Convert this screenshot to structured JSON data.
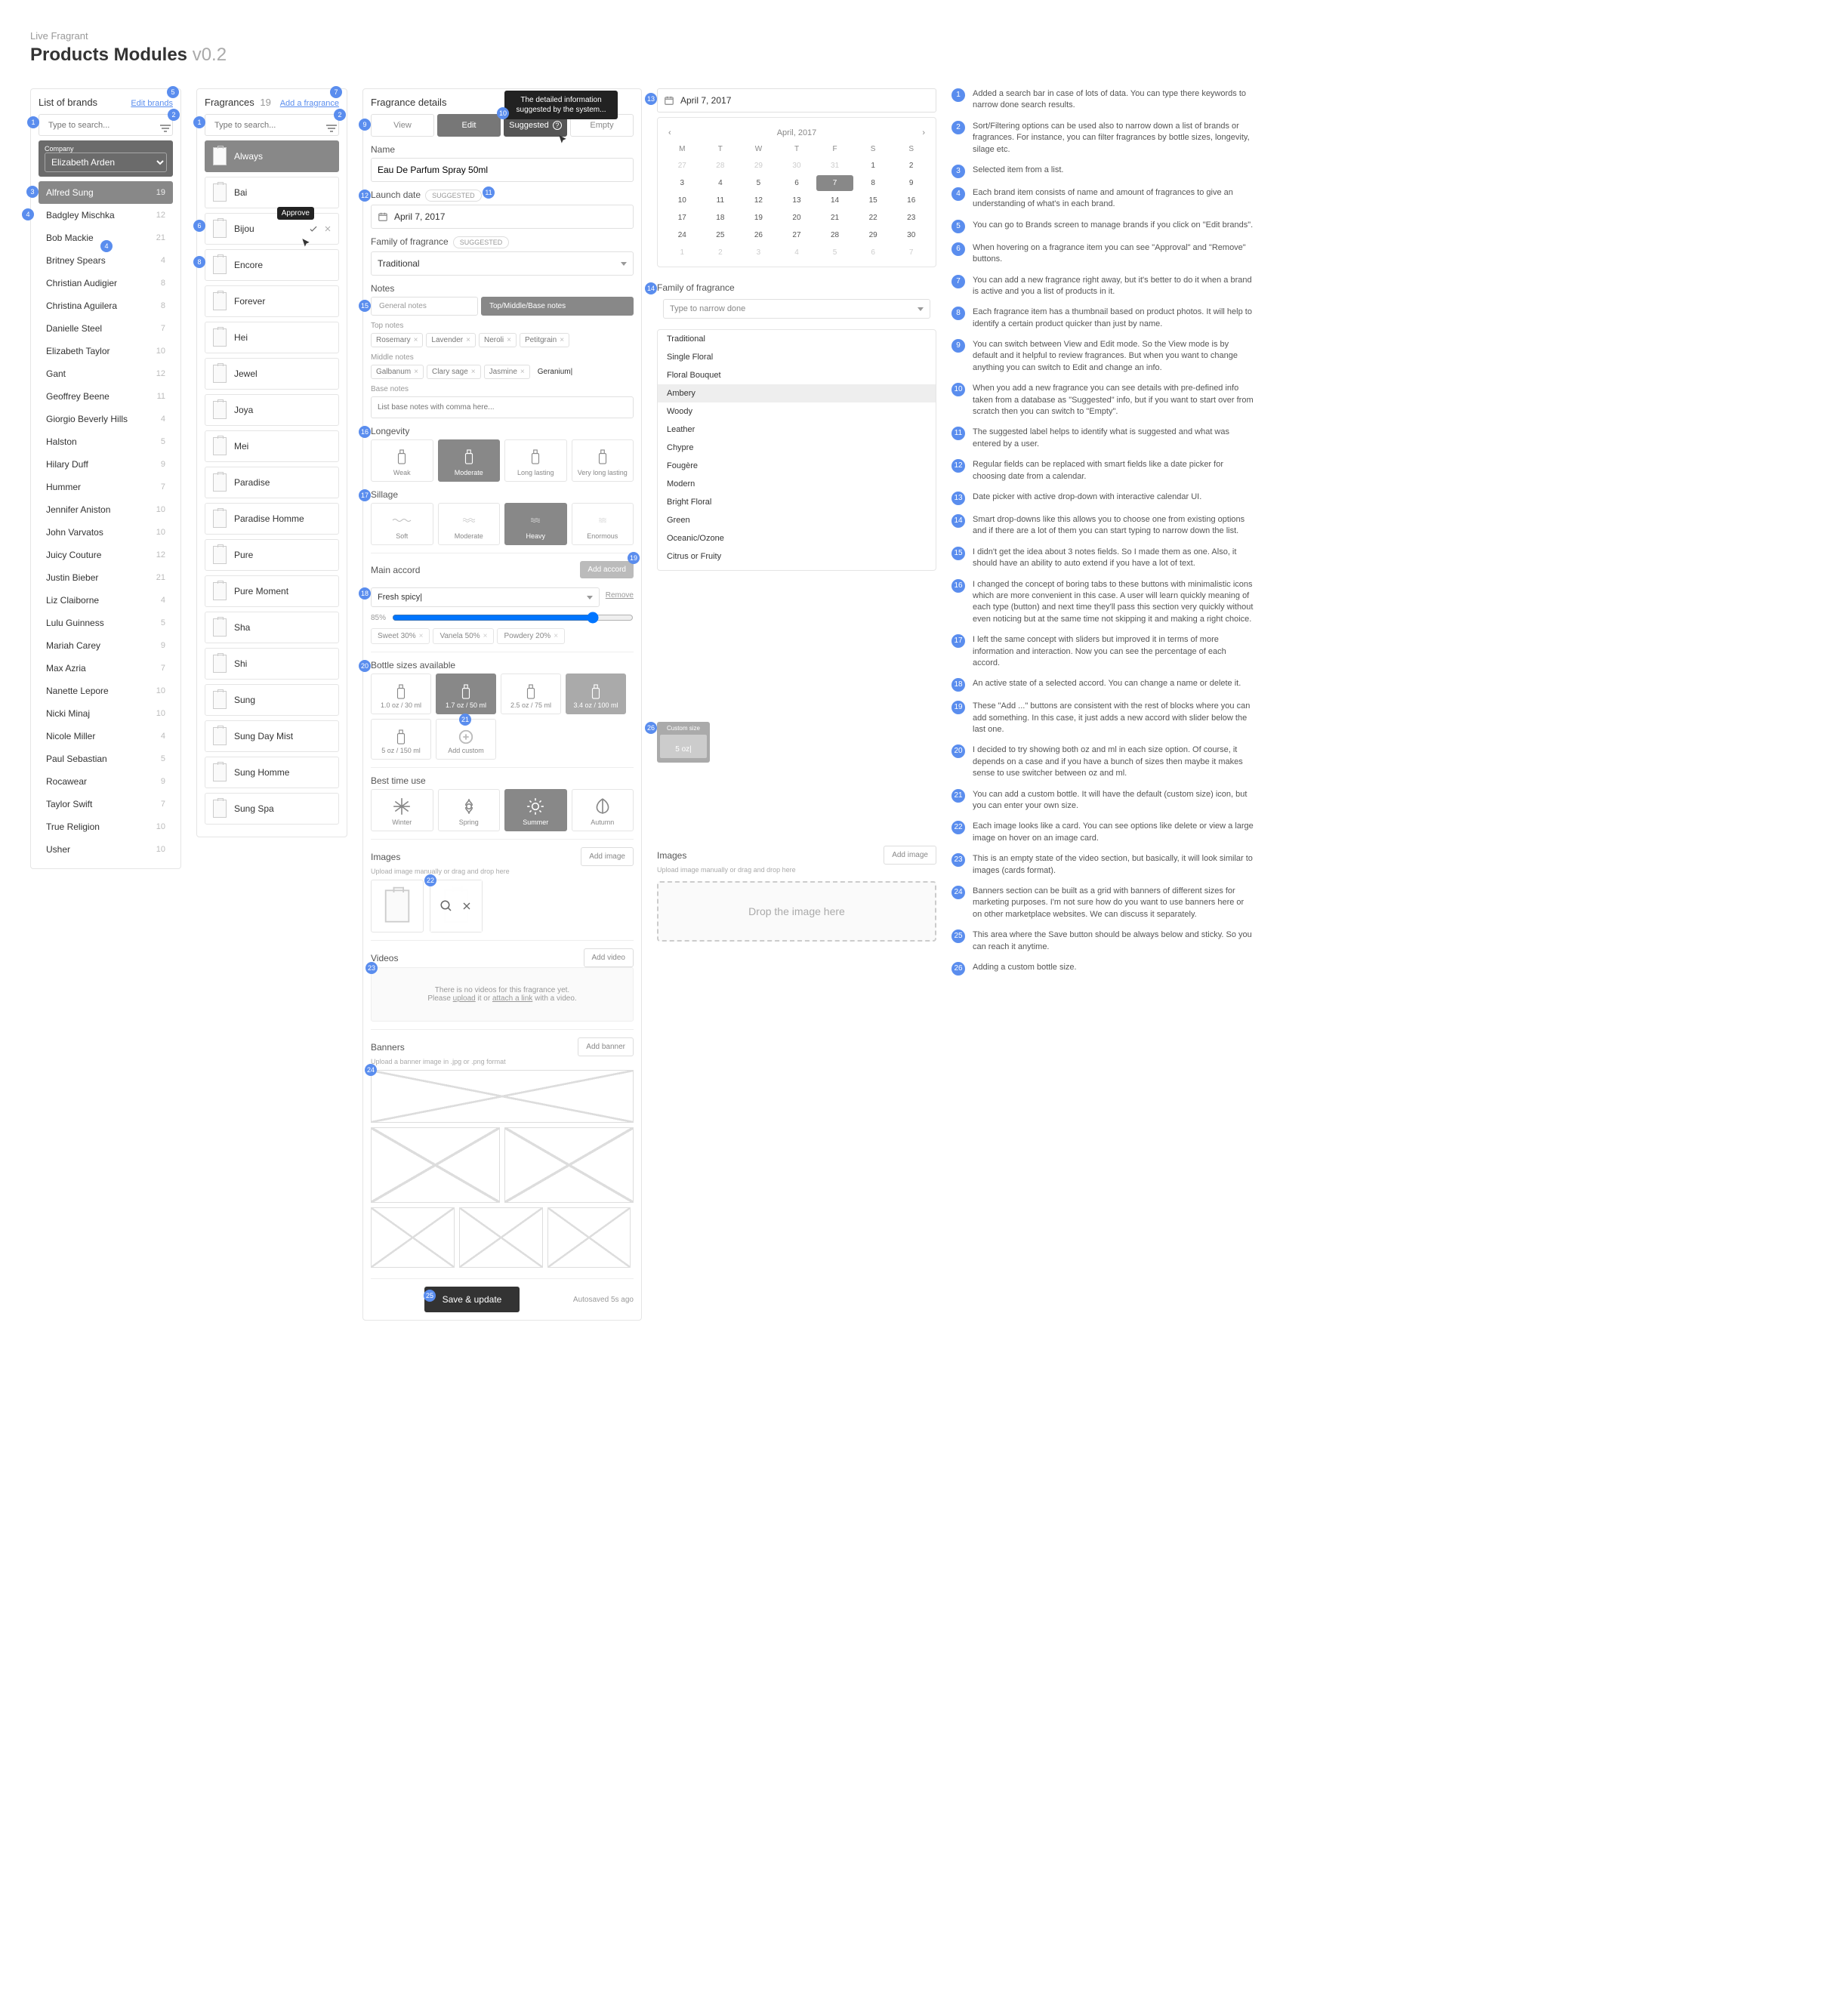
{
  "header": {
    "breadcrumb": "Live Fragrant",
    "title": "Products Modules",
    "version": "v0.2"
  },
  "brands_panel": {
    "title": "List of brands",
    "edit_link": "Edit brands",
    "search_placeholder": "Type to search...",
    "company_label": "Company",
    "company_value": "Elizabeth Arden",
    "items": [
      {
        "name": "Alfred Sung",
        "count": 19,
        "selected": true
      },
      {
        "name": "Badgley Mischka",
        "count": 12
      },
      {
        "name": "Bob Mackie",
        "count": 21
      },
      {
        "name": "Britney Spears",
        "count": 4
      },
      {
        "name": "Christian Audigier",
        "count": 8
      },
      {
        "name": "Christina Aguilera",
        "count": 8
      },
      {
        "name": "Danielle Steel",
        "count": 7
      },
      {
        "name": "Elizabeth Taylor",
        "count": 10
      },
      {
        "name": "Gant",
        "count": 12
      },
      {
        "name": "Geoffrey Beene",
        "count": 11
      },
      {
        "name": "Giorgio Beverly Hills",
        "count": 4
      },
      {
        "name": "Halston",
        "count": 5
      },
      {
        "name": "Hilary Duff",
        "count": 9
      },
      {
        "name": "Hummer",
        "count": 7
      },
      {
        "name": "Jennifer Aniston",
        "count": 10
      },
      {
        "name": "John Varvatos",
        "count": 10
      },
      {
        "name": "Juicy Couture",
        "count": 12
      },
      {
        "name": "Justin Bieber",
        "count": 21
      },
      {
        "name": "Liz Claiborne",
        "count": 4
      },
      {
        "name": "Lulu Guinness",
        "count": 5
      },
      {
        "name": "Mariah Carey",
        "count": 9
      },
      {
        "name": "Max Azria",
        "count": 7
      },
      {
        "name": "Nanette Lepore",
        "count": 10
      },
      {
        "name": "Nicki Minaj",
        "count": 10
      },
      {
        "name": "Nicole Miller",
        "count": 4
      },
      {
        "name": "Paul Sebastian",
        "count": 5
      },
      {
        "name": "Rocawear",
        "count": 9
      },
      {
        "name": "Taylor Swift",
        "count": 7
      },
      {
        "name": "True Religion",
        "count": 10
      },
      {
        "name": "Usher",
        "count": 10
      }
    ]
  },
  "fragrances_panel": {
    "title": "Fragrances",
    "count": 19,
    "add_link": "Add a fragrance",
    "search_placeholder": "Type to search...",
    "tooltip_approve": "Approve",
    "items": [
      "Always",
      "Bai",
      "Bijou",
      "Encore",
      "Forever",
      "Hei",
      "Jewel",
      "Joya",
      "Mei",
      "Paradise",
      "Paradise Homme",
      "Pure",
      "Pure Moment",
      "Sha",
      "Shi",
      "Sung",
      "Sung Day Mist",
      "Sung Homme",
      "Sung Spa"
    ],
    "active_index": 0,
    "hover_index": 2
  },
  "details": {
    "title": "Fragrance details",
    "tabs": {
      "view": "View",
      "edit": "Edit",
      "suggested": "Suggested",
      "empty": "Empty",
      "tooltip": "The detailed information suggested by the system..."
    },
    "name_label": "Name",
    "name_value": "Eau De Parfum Spray 50ml",
    "launch_label": "Launch date",
    "launch_badge": "SUGGESTED",
    "launch_value": "April 7, 2017",
    "family_label": "Family of fragrance",
    "family_badge": "SUGGESTED",
    "family_value": "Traditional",
    "notes_label": "Notes",
    "notes_tabs": {
      "general": "General notes",
      "tmb": "Top/Middle/Base notes"
    },
    "top_label": "Top notes",
    "top": [
      "Rosemary",
      "Lavender",
      "Neroli",
      "Petitgrain"
    ],
    "mid_label": "Middle notes",
    "mid": [
      "Galbanum",
      "Clary sage",
      "Jasmine"
    ],
    "mid_new": "Geranium|",
    "base_label": "Base notes",
    "base_placeholder": "List base notes with comma here...",
    "longevity_label": "Longevity",
    "longevity": [
      "Weak",
      "Moderate",
      "Long lasting",
      "Very long lasting"
    ],
    "longevity_sel": 1,
    "sillage_label": "Sillage",
    "sillage": [
      "Soft",
      "Moderate",
      "Heavy",
      "Enormous"
    ],
    "sillage_sel": 2,
    "accord_label": "Main accord",
    "add_accord": "Add accord",
    "accord_name": "Fresh spicy|",
    "accord_remove": "Remove",
    "accord_pct": "85%",
    "accord_chips": [
      {
        "n": "Sweet",
        "p": "30%"
      },
      {
        "n": "Vanela",
        "p": "50%"
      },
      {
        "n": "Powdery",
        "p": "20%"
      }
    ],
    "sizes_label": "Bottle sizes available",
    "sizes": [
      {
        "l": "1.0 oz / 30 ml"
      },
      {
        "l": "1.7 oz / 50 ml",
        "a": 1
      },
      {
        "l": "2.5 oz / 75 ml"
      },
      {
        "l": "3.4 oz / 100 ml",
        "alt": 1
      },
      {
        "l": "5 oz / 150 ml"
      },
      {
        "l": "Add custom",
        "add": 1
      }
    ],
    "season_label": "Best time use",
    "seasons": [
      "Winter",
      "Spring",
      "Summer",
      "Autumn"
    ],
    "season_sel": 2,
    "images_label": "Images",
    "add_image": "Add image",
    "upload_hint": "Upload image manually or drag and drop here",
    "videos_label": "Videos",
    "add_video": "Add video",
    "video_empty_1": "There is no videos for this fragrance yet.",
    "video_empty_2a": "Please ",
    "video_upload": "upload",
    "video_or": " it or ",
    "video_attach": "attach a link",
    "video_with": " with a video.",
    "banners_label": "Banners",
    "add_banner": "Add banner",
    "banner_hint": "Upload a banner image in .jpg or .png format",
    "save": "Save & update",
    "autosave": "Autosaved 5s ago"
  },
  "calendar": {
    "input": "April 7, 2017",
    "month": "April, 2017",
    "dow": [
      "M",
      "T",
      "W",
      "T",
      "F",
      "S",
      "S"
    ],
    "days": [
      27,
      28,
      29,
      30,
      31,
      1,
      2,
      3,
      4,
      5,
      6,
      7,
      8,
      9,
      10,
      11,
      12,
      13,
      14,
      15,
      16,
      17,
      18,
      19,
      20,
      21,
      22,
      23,
      24,
      25,
      26,
      27,
      28,
      29,
      30,
      1,
      2,
      3,
      4,
      5,
      6,
      7
    ],
    "muted_head": 5,
    "muted_tail": 7,
    "sel_index": 11
  },
  "family_dd": {
    "label": "Family of fragrance",
    "placeholder": "Type to narrow done",
    "sel": "Ambery",
    "items": [
      "Traditional",
      "Single Floral",
      "Floral Bouquet",
      "Ambery",
      "Woody",
      "Leather",
      "Chypre",
      "Fougère",
      "Modern",
      "Bright Floral",
      "Green",
      "Oceanic/Ozone",
      "Citrus or Fruity"
    ]
  },
  "custom_bottle": {
    "title": "Custom size",
    "val": "5 oz|"
  },
  "images_side": {
    "label": "Images",
    "add": "Add image",
    "hint": "Upload image manually or drag and drop here",
    "drop": "Drop the image here"
  },
  "annotations": [
    "Added a search bar in case of lots of data. You can type there keywords to narrow done search results.",
    "Sort/Filtering options can be used also to narrow down a list of brands or fragrances. For instance, you can filter fragrances by bottle sizes, longevity, silage etc.",
    "Selected item from a list.",
    "Each brand item consists of name and amount of fragrances to give an understanding of what's in each brand.",
    "You can go to Brands screen to manage brands if you click on \"Edit brands\".",
    "When hovering on a fragrance item you can see \"Approval\" and \"Remove\" buttons.",
    "You can add a new fragrance right away, but it's better to do it when a brand is active and you a list of products in it.",
    "Each fragrance item has a thumbnail based on product photos. It will help to identify a certain product quicker than just by name.",
    "You can switch between View and Edit mode. So the View mode is by default and it helpful to review fragrances. But when you want to change anything you can switch to Edit and change an info.",
    "When you add a new fragrance you can see details with pre-defined info taken from a database as \"Suggested\" info, but if you want to start over from scratch then you can switch to \"Empty\".",
    "The suggested label helps to identify what is suggested and what was entered by a user.",
    "Regular fields can be replaced with smart fields like a date picker for choosing date from a calendar.",
    "Date picker with active drop-down with interactive calendar UI.",
    "Smart drop-downs like this allows you to choose one from existing options and if there are a lot of them you can start typing to narrow down the list.",
    "I didn't get the idea about 3 notes fields. So I made them as one. Also, it should have an ability to auto extend if you have a lot of text.",
    "I changed the concept of boring tabs to these buttons with minimalistic icons which are more convenient in this case. A user will learn quickly meaning of each type (button) and next time they'll pass this section very quickly without even noticing but at the same time not skipping it and making a right choice.",
    "I left the same concept with sliders but improved it in terms of more information and interaction. Now you can see the percentage of each accord.",
    "An active state of a selected accord. You can change a name or delete it.",
    "These \"Add ...\" buttons are consistent with the rest of blocks where you can add something. In this case, it just adds a new accord with slider below the last one.",
    "I decided to try showing both oz and ml in each size option. Of course, it depends on a case and if you have a bunch of sizes then maybe it makes sense to use switcher between oz and ml.",
    "You can add a custom bottle. It will have the default (custom size) icon, but you can enter your own size.",
    "Each image looks like a card. You can see options like delete or view a large image on hover on an image card.",
    "This is an empty state of the video section, but basically, it will look similar to images (cards format).",
    "Banners section can be built as a grid with banners of different sizes for marketing purposes. I'm not sure how do you want to use banners here or on other marketplace websites. We can discuss it separately.",
    "This area where the Save button should be always below and sticky. So you can reach it anytime.",
    "Adding a custom bottle size."
  ]
}
